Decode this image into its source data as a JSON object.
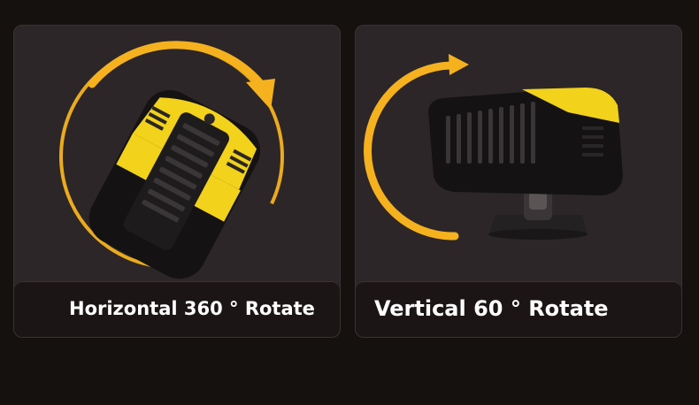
{
  "colors": {
    "background": "#15110f",
    "card": "#2d2628",
    "label_bar": "#1c1516",
    "accent": "#f5b21e",
    "product_yellow": "#f2d21a",
    "product_black": "#141213"
  },
  "panels": [
    {
      "label": "Horizontal 360 ° Rotate",
      "icon": "rotate-horizontal-arrow-icon"
    },
    {
      "label": "Vertical 60 ° Rotate",
      "icon": "rotate-vertical-arrow-icon"
    }
  ]
}
